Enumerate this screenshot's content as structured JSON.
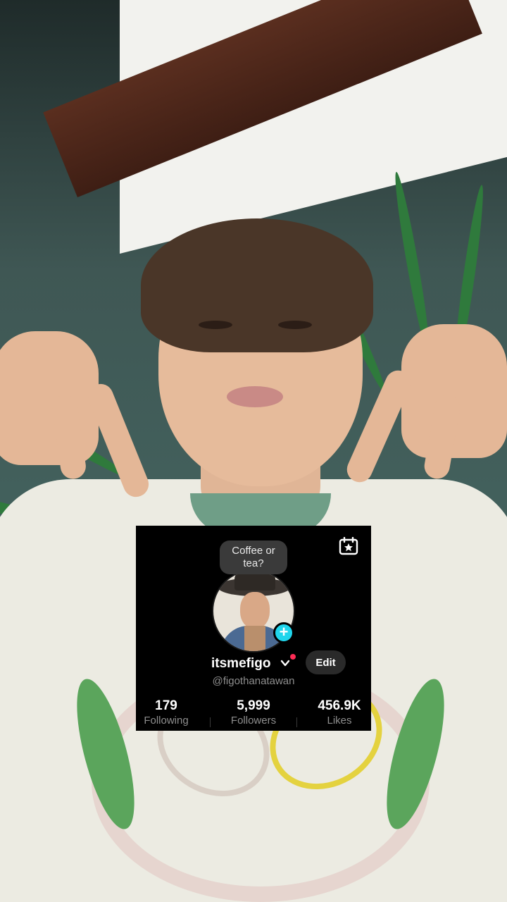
{
  "profile_card": {
    "note": "Coffee or tea?",
    "username": "itsmefigo",
    "handle": "@figothanatawan",
    "edit_label": "Edit",
    "stats": [
      {
        "value": "179",
        "label": "Following"
      },
      {
        "value": "5,999",
        "label": "Followers"
      },
      {
        "value": "456.9K",
        "label": "Likes"
      }
    ],
    "icons": {
      "calendar": "calendar-star-icon",
      "add": "plus-icon",
      "chevron": "chevron-down-icon"
    },
    "colors": {
      "card_bg": "#000000",
      "add_badge": "#20D5EC",
      "notification_dot": "#FE2C55",
      "secondary_text": "#8E8E8E"
    }
  }
}
